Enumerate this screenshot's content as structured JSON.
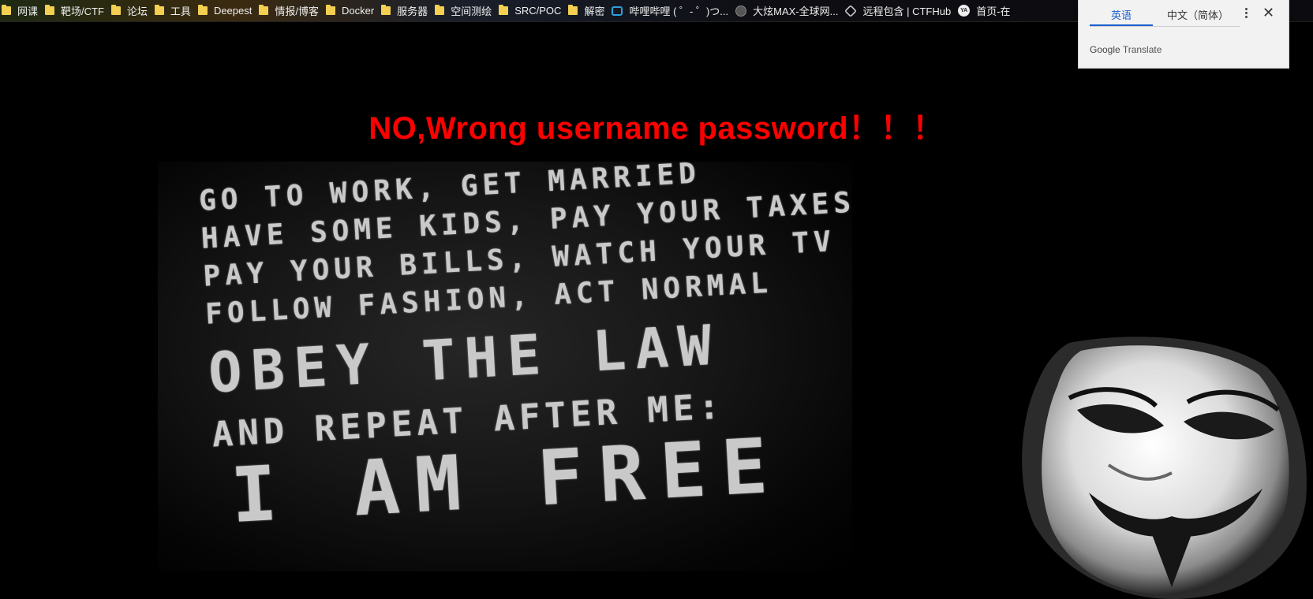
{
  "bookmarks": [
    {
      "label": "网课",
      "icon": "folder-icon"
    },
    {
      "label": "靶场/CTF",
      "icon": "folder-icon"
    },
    {
      "label": "论坛",
      "icon": "folder-icon"
    },
    {
      "label": "工具",
      "icon": "folder-icon"
    },
    {
      "label": "Deepest",
      "icon": "folder-icon"
    },
    {
      "label": "情报/博客",
      "icon": "folder-icon"
    },
    {
      "label": "Docker",
      "icon": "folder-icon"
    },
    {
      "label": "服务器",
      "icon": "folder-icon"
    },
    {
      "label": "空间测绘",
      "icon": "folder-icon"
    },
    {
      "label": "SRC/POC",
      "icon": "folder-icon"
    },
    {
      "label": "解密",
      "icon": "folder-icon"
    },
    {
      "label": "哔哩哔哩 ( ゜- ゜)つ...",
      "icon": "bilibili-tv-icon"
    },
    {
      "label": "大炫MAX-全球网...",
      "icon": "globe-icon"
    },
    {
      "label": "远程包含 | CTFHub",
      "icon": "ctfhub-icon"
    },
    {
      "label": "首页-在",
      "icon": "ya-avatar-icon"
    }
  ],
  "translate": {
    "tab_source": "英语",
    "tab_target": "中文（简体）",
    "brand_google": "Google",
    "brand_translate": "Translate"
  },
  "error_message": "NO,Wrong username password！！！",
  "wall": {
    "line1": "GO TO WORK, GET MARRIED",
    "line2": "HAVE SOME KIDS, PAY YOUR TAXES",
    "line3": "PAY YOUR BILLS, WATCH YOUR TV",
    "line4": "FOLLOW FASHION, ACT NORMAL",
    "line5": "OBEY THE LAW",
    "line6": "AND REPEAT AFTER ME:",
    "line7": "I AM FREE"
  }
}
